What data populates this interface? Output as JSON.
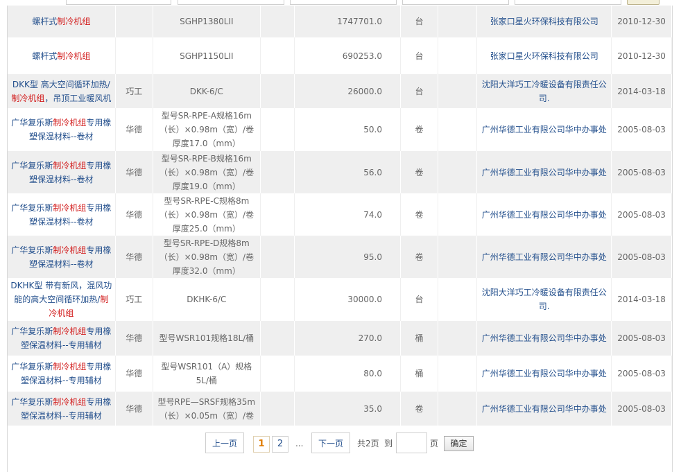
{
  "rows": [
    {
      "name_pre": "螺杆式",
      "name_hl": "制冷机组",
      "name_post": "",
      "brand": "",
      "spec": "SGHP1380LII",
      "price": "1747701.0",
      "unit": "台",
      "company": "张家口星火环保科技有限公司",
      "date": "2010-12-30"
    },
    {
      "name_pre": "螺杆式",
      "name_hl": "制冷机组",
      "name_post": "",
      "brand": "",
      "spec": "SGHP1150LII",
      "price": "690253.0",
      "unit": "台",
      "company": "张家口星火环保科技有限公司",
      "date": "2010-12-30"
    },
    {
      "name_pre": "DKK型 高大空间循环加热/",
      "name_hl": "制冷机组",
      "name_post": "，吊顶工业暖风机",
      "brand": "巧工",
      "spec": "DKK-6/C",
      "price": "26000.0",
      "unit": "台",
      "company": "沈阳大洋巧工冷暖设备有限责任公司.",
      "date": "2014-03-18"
    },
    {
      "name_pre": "广华复乐斯",
      "name_hl": "制冷机组",
      "name_post": "专用橡塑保温材料--卷材",
      "brand": "华德",
      "spec": "型号SR-RPE-A规格16m（长）×0.98m（宽）/卷厚度17.0（mm）",
      "price": "50.0",
      "unit": "卷",
      "company": "广州华德工业有限公司华中办事处",
      "date": "2005-08-03"
    },
    {
      "name_pre": "广华复乐斯",
      "name_hl": "制冷机组",
      "name_post": "专用橡塑保温材料--卷材",
      "brand": "华德",
      "spec": "型号SR-RPE-B规格16m（长）×0.98m（宽）/卷厚度19.0（mm）",
      "price": "56.0",
      "unit": "卷",
      "company": "广州华德工业有限公司华中办事处",
      "date": "2005-08-03"
    },
    {
      "name_pre": "广华复乐斯",
      "name_hl": "制冷机组",
      "name_post": "专用橡塑保温材料--卷材",
      "brand": "华德",
      "spec": "型号SR-RPE-C规格8m（长）×0.98m（宽）/卷厚度25.0（mm）",
      "price": "74.0",
      "unit": "卷",
      "company": "广州华德工业有限公司华中办事处",
      "date": "2005-08-03"
    },
    {
      "name_pre": "广华复乐斯",
      "name_hl": "制冷机组",
      "name_post": "专用橡塑保温材料--卷材",
      "brand": "华德",
      "spec": "型号SR-RPE-D规格8m（长）×0.98m（宽）/卷厚度32.0（mm）",
      "price": "95.0",
      "unit": "卷",
      "company": "广州华德工业有限公司华中办事处",
      "date": "2005-08-03"
    },
    {
      "name_pre": "DKHK型 带有新风，混风功能的高大空间循环加热/",
      "name_hl": "制冷机组",
      "name_post": "",
      "brand": "巧工",
      "spec": "DKHK-6/C",
      "price": "30000.0",
      "unit": "台",
      "company": "沈阳大洋巧工冷暖设备有限责任公司.",
      "date": "2014-03-18"
    },
    {
      "name_pre": "广华复乐斯",
      "name_hl": "制冷机组",
      "name_post": "专用橡塑保温材料--专用辅材",
      "brand": "华德",
      "spec": "型号WSR101规格18L/桶",
      "price": "270.0",
      "unit": "桶",
      "company": "广州华德工业有限公司华中办事处",
      "date": "2005-08-03"
    },
    {
      "name_pre": "广华复乐斯",
      "name_hl": "制冷机组",
      "name_post": "专用橡塑保温材料--专用辅材",
      "brand": "华德",
      "spec": "型号WSR101（A）规格5L/桶",
      "price": "80.0",
      "unit": "桶",
      "company": "广州华德工业有限公司华中办事处",
      "date": "2005-08-03"
    },
    {
      "name_pre": "广华复乐斯",
      "name_hl": "制冷机组",
      "name_post": "专用橡塑保温材料--专用辅材",
      "brand": "华德",
      "spec": "型号RPE—SRSF规格35m（长）×0.05m（宽）/卷",
      "price": "35.0",
      "unit": "卷",
      "company": "广州华德工业有限公司华中办事处",
      "date": "2005-08-03"
    }
  ],
  "pager": {
    "prev": "上一页",
    "pages": [
      "1",
      "2"
    ],
    "ellipsis": "...",
    "next": "下一页",
    "total": "共2页",
    "goto": "到",
    "page_unit": "页",
    "confirm": "确定"
  }
}
